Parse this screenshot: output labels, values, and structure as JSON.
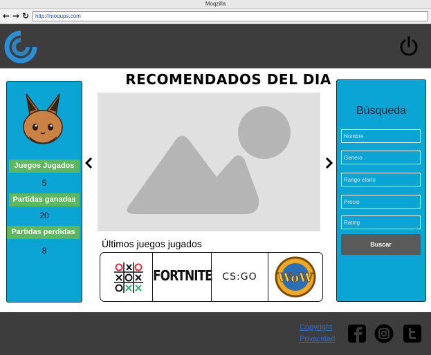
{
  "browser": {
    "window_title": "Moqzilla",
    "url": "http://moqups.com",
    "back_glyph": "←",
    "forward_glyph": "→",
    "reload_glyph": "↻"
  },
  "header": {
    "logo_icon": "circular-spinner-logo-icon",
    "power_icon": "power-icon",
    "colors": {
      "background": "#3d3d3d",
      "logo_blue": "#2b8fd8"
    }
  },
  "stats": {
    "avatar_icon": "eevee-avatar-icon",
    "items": [
      {
        "label": "Juegos Jugados",
        "value": "5"
      },
      {
        "label": "Partidas ganadas",
        "value": "20"
      },
      {
        "label": "Partidas perdidas",
        "value": "8"
      }
    ],
    "colors": {
      "panel": "#0aa5d4",
      "label_bg": "#5cb85c"
    }
  },
  "main": {
    "title": "RECOMENDADOS DEL DIA",
    "image_placeholder_icon": "image-placeholder-icon",
    "prev_icon": "chevron-left-icon",
    "next_icon": "chevron-right-icon",
    "recent_label": "Últimos juegos jugados",
    "games": [
      {
        "name": "tic-tac-toe",
        "icon": "tic-tac-toe-icon"
      },
      {
        "name": "fortnite",
        "logo_text": "FORTNITE"
      },
      {
        "name": "csgo",
        "logo_text": "CS:GO"
      },
      {
        "name": "wow",
        "logo_text": "WoW"
      }
    ]
  },
  "search": {
    "title": "Búsqueda",
    "fields": [
      {
        "placeholder": "Nombre"
      },
      {
        "placeholder": "Genero"
      },
      {
        "placeholder": "Rango etario"
      },
      {
        "placeholder": "Precio"
      },
      {
        "placeholder": "Rating"
      }
    ],
    "button_label": "Buscar"
  },
  "footer": {
    "links": [
      "Copyright",
      "Privacidad"
    ],
    "social_icons": [
      "facebook-icon",
      "instagram-icon",
      "twitter-icon"
    ]
  }
}
